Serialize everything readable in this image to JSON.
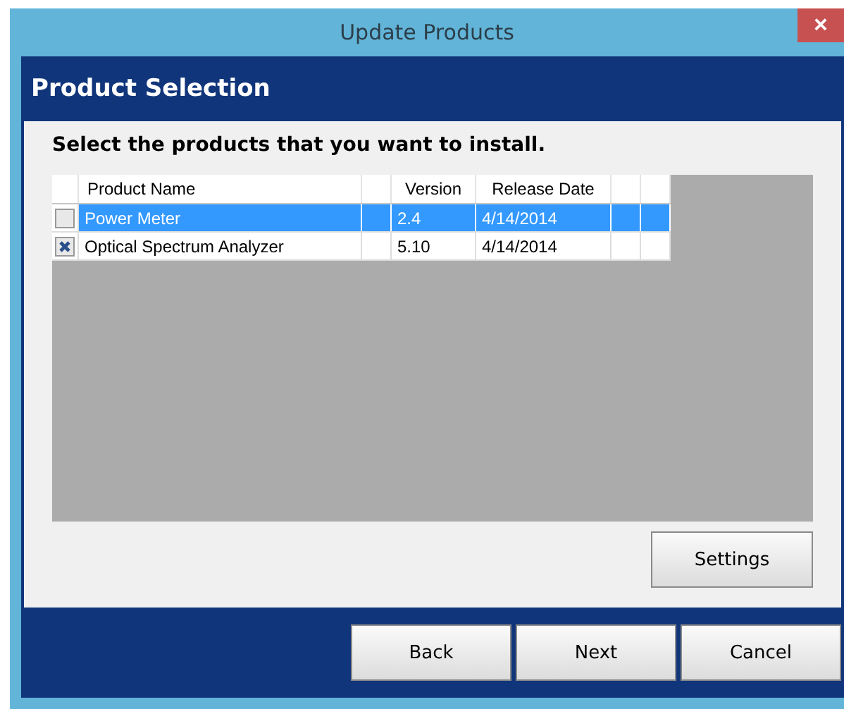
{
  "window": {
    "title": "Update Products",
    "close": "×"
  },
  "header": {
    "title": "Product Selection"
  },
  "instruction": "Select the products that you want to install.",
  "table": {
    "columns": [
      {
        "label": "Product Name"
      },
      {
        "label": "Version"
      },
      {
        "label": "Release Date"
      }
    ],
    "rows": [
      {
        "checked": false,
        "selected": true,
        "name": "Power Meter",
        "version": "2.4",
        "release_date": "4/14/2014"
      },
      {
        "checked": true,
        "selected": false,
        "name": "Optical Spectrum Analyzer",
        "version": "5.10",
        "release_date": "4/14/2014"
      }
    ]
  },
  "settings_button": "Settings",
  "buttons": [
    "Back",
    "Next",
    "Cancel"
  ]
}
